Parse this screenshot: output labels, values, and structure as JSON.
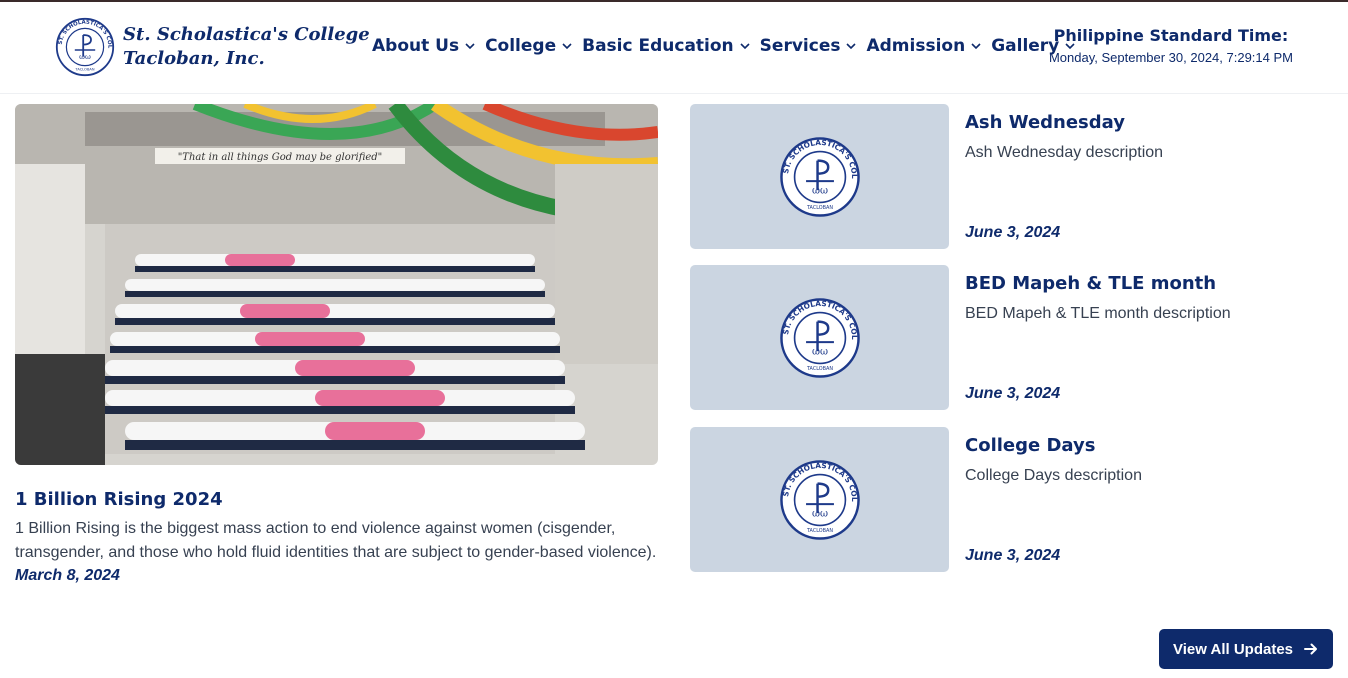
{
  "header": {
    "brand_line1": "St. Scholastica's College",
    "brand_line2": "Tacloban, Inc.",
    "brand_color": "#0e2a6b"
  },
  "nav": {
    "items": [
      {
        "label": "About Us",
        "icon": "chevron-down-icon"
      },
      {
        "label": "College",
        "icon": "chevron-down-icon"
      },
      {
        "label": "Basic Education",
        "icon": "chevron-down-icon"
      },
      {
        "label": "Services",
        "icon": "chevron-down-icon"
      },
      {
        "label": "Admission",
        "icon": "chevron-down-icon"
      },
      {
        "label": "Gallery",
        "icon": "chevron-down-icon"
      }
    ]
  },
  "clock": {
    "title": "Philippine Standard Time:",
    "value": "Monday, September 30, 2024, 7:29:14 PM"
  },
  "featured": {
    "title": "1 Billion Rising 2024",
    "description": "1 Billion Rising is the biggest mass action to end violence against women (cisgender, transgender, and those who hold fluid identities that are subject to gender-based violence).",
    "date": "March 8, 2024",
    "banner_text": "\"That in all things God may be glorified\""
  },
  "updates": [
    {
      "title": "Ash Wednesday",
      "description": "Ash Wednesday description",
      "date": "June 3, 2024"
    },
    {
      "title": "BED Mapeh & TLE month",
      "description": "BED Mapeh & TLE month description",
      "date": "June 3, 2024"
    },
    {
      "title": "College Days",
      "description": "College Days description",
      "date": "June 3, 2024"
    }
  ],
  "view_all": {
    "label": "View All Updates",
    "icon": "arrow-right-icon"
  },
  "seal": {
    "ring_text": "ST. SCHOLASTICA'S COLLEGE",
    "bottom_text": "TACLOBAN"
  }
}
